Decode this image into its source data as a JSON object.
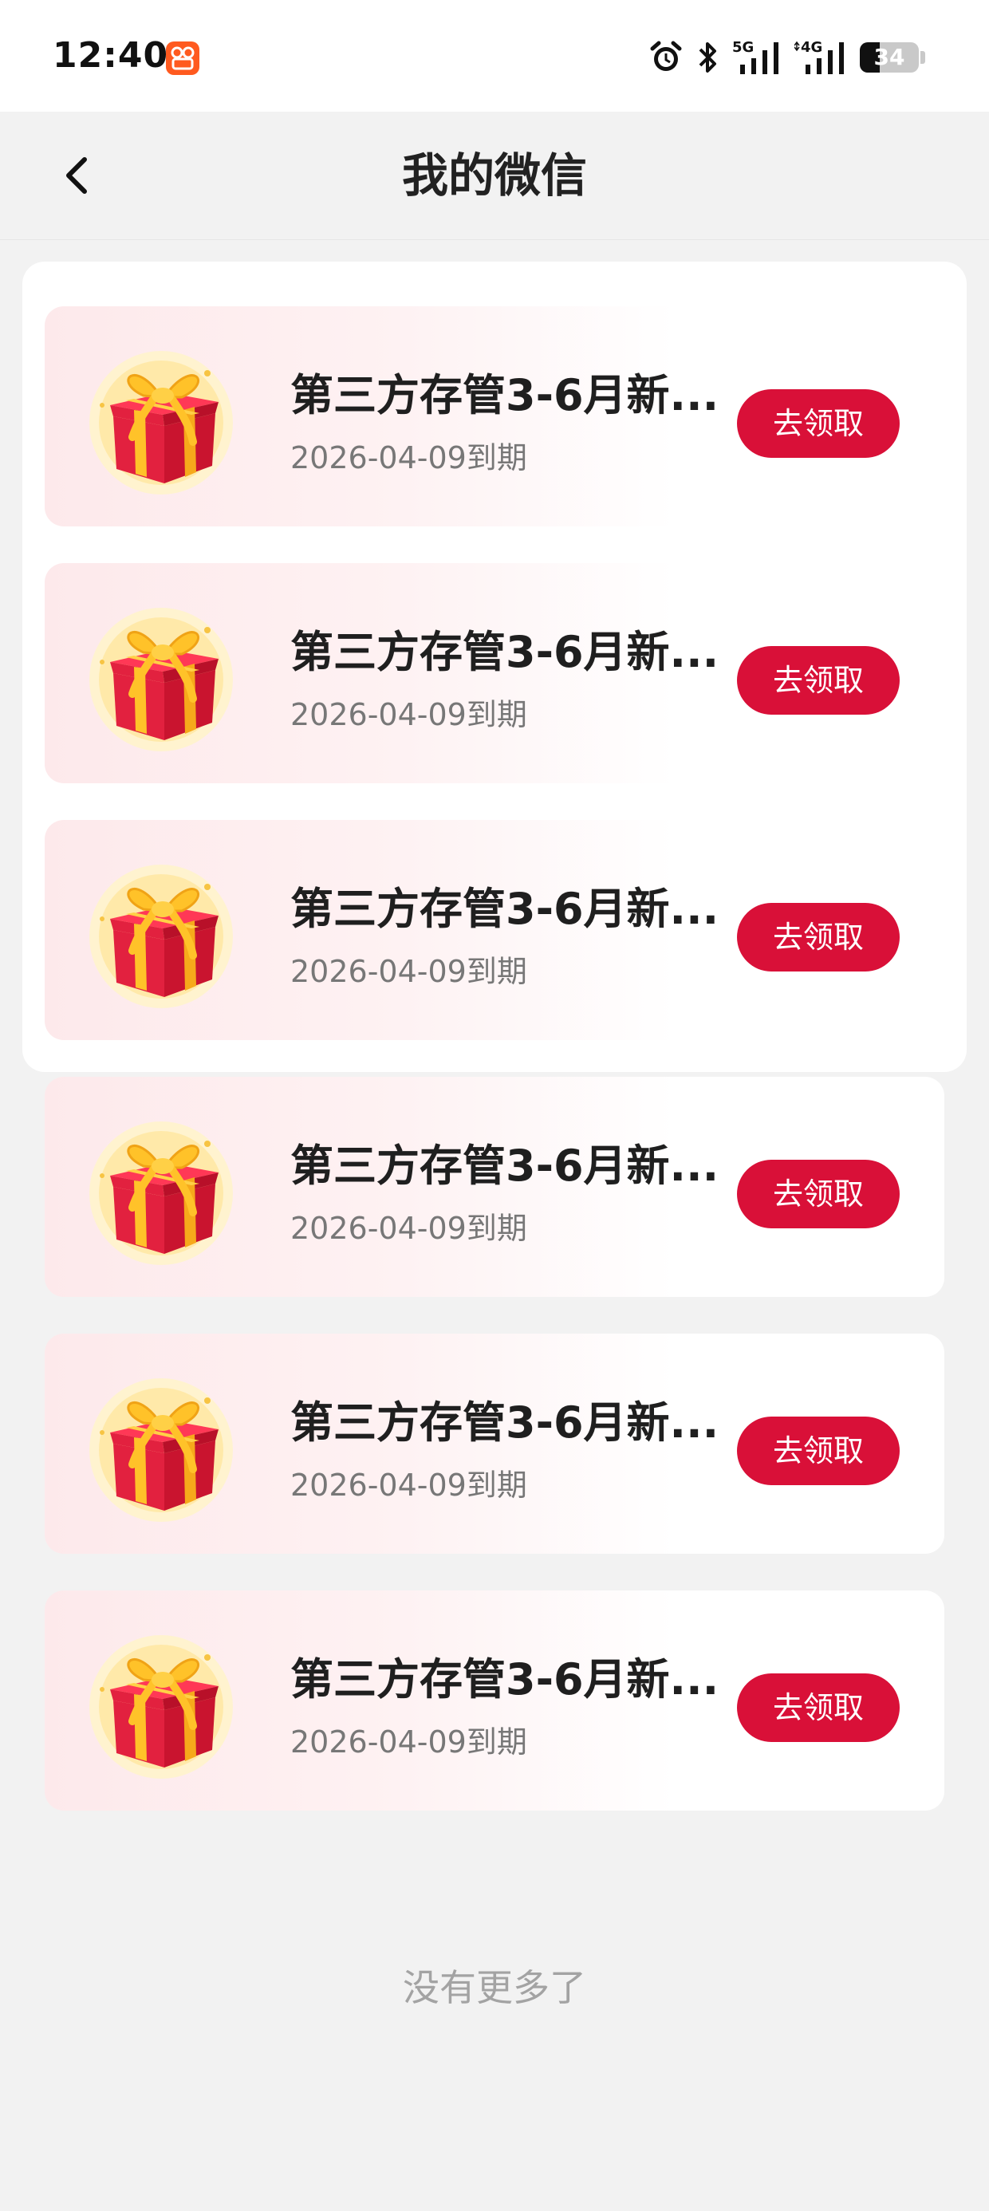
{
  "status_bar": {
    "time": "12:40",
    "network_1": "5G",
    "network_2": "4G",
    "battery_level": "34"
  },
  "header": {
    "title": "我的微信"
  },
  "gift_list": [
    {
      "title": "第三方存管3-6月新...",
      "expiry": "2026-04-09到期",
      "button_label": "去领取"
    },
    {
      "title": "第三方存管3-6月新...",
      "expiry": "2026-04-09到期",
      "button_label": "去领取"
    },
    {
      "title": "第三方存管3-6月新...",
      "expiry": "2026-04-09到期",
      "button_label": "去领取"
    },
    {
      "title": "第三方存管3-6月新...",
      "expiry": "2026-04-09到期",
      "button_label": "去领取"
    },
    {
      "title": "第三方存管3-6月新...",
      "expiry": "2026-04-09到期",
      "button_label": "去领取"
    },
    {
      "title": "第三方存管3-6月新...",
      "expiry": "2026-04-09到期",
      "button_label": "去领取"
    }
  ],
  "footer": {
    "no_more_text": "没有更多了"
  },
  "colors": {
    "accent": "#d91038",
    "page_background": "#f2f2f2"
  },
  "icons": {
    "back": "chevron-left-icon",
    "gift": "gift-box-icon",
    "alarm": "alarm-icon",
    "bluetooth": "bluetooth-icon",
    "app_badge": "app-notification-icon"
  }
}
